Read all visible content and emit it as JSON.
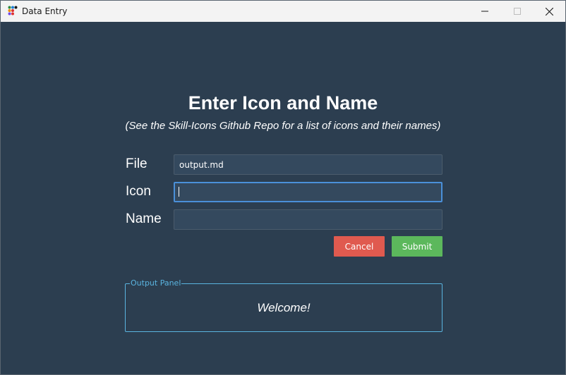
{
  "window": {
    "title": "Data Entry",
    "app_icon": "colored-dots-icon",
    "controls": [
      "minimize-icon",
      "maximize-icon",
      "close-icon"
    ]
  },
  "header": {
    "title": "Enter Icon and Name",
    "subtitle": "(See the Skill-Icons Github Repo for a list of icons and their names)"
  },
  "form": {
    "file": {
      "label": "File",
      "value": "output.md"
    },
    "icon": {
      "label": "Icon",
      "value": ""
    },
    "name": {
      "label": "Name",
      "value": ""
    },
    "cancel_label": "Cancel",
    "submit_label": "Submit"
  },
  "output": {
    "panel_title": "Output Panel",
    "message": "Welcome!"
  },
  "colors": {
    "background": "#2c3e50",
    "input_background": "#34495e",
    "cancel": "#e05a4f",
    "submit": "#5cb85c",
    "panel_border": "#5ab4e0",
    "focus": "#4a90d9"
  }
}
